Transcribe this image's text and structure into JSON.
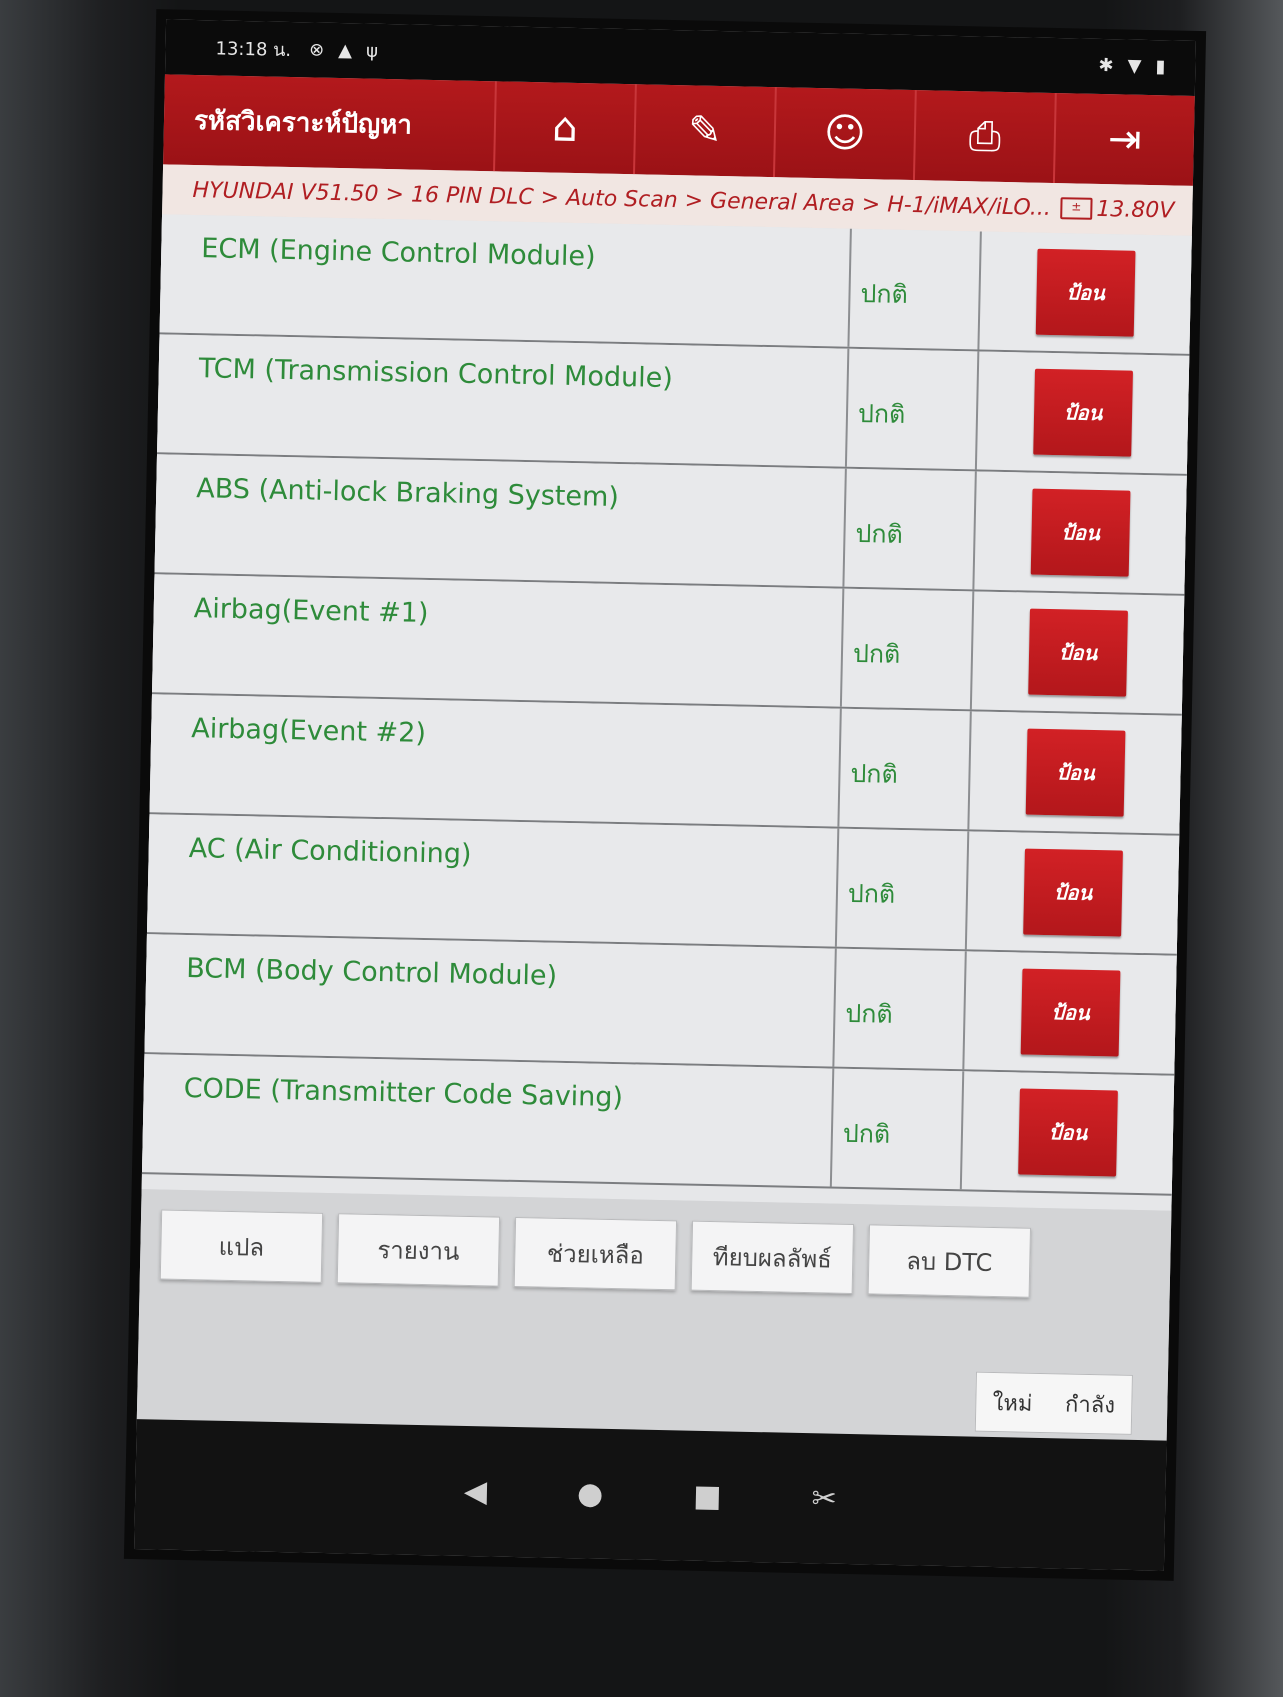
{
  "status_bar": {
    "time": "13:18 น.",
    "icons": [
      "no-disturb-icon",
      "warning-icon",
      "usb-debug-icon"
    ],
    "right_icons": [
      "bluetooth-icon",
      "wifi-icon",
      "battery-icon"
    ]
  },
  "app_bar": {
    "title": "รหัสวิเคราะห์ปัญหา",
    "nav": [
      {
        "icon": "home-icon",
        "glyph": "⌂"
      },
      {
        "icon": "edit-icon",
        "glyph": "✎"
      },
      {
        "icon": "support-icon",
        "glyph": "☺"
      },
      {
        "icon": "print-icon",
        "glyph": "⎙"
      },
      {
        "icon": "exit-icon",
        "glyph": "⇥"
      }
    ]
  },
  "breadcrumb": {
    "path": "HYUNDAI V51.50 > 16 PIN DLC > Auto Scan > General Area > H-1/iMAX/iLO...",
    "voltage": "13.80V"
  },
  "modules": [
    {
      "name": "ECM (Engine Control Module)",
      "status": "ปกติ",
      "action": "ป้อน"
    },
    {
      "name": "TCM (Transmission Control Module)",
      "status": "ปกติ",
      "action": "ป้อน"
    },
    {
      "name": "ABS (Anti-lock Braking System)",
      "status": "ปกติ",
      "action": "ป้อน"
    },
    {
      "name": "Airbag(Event #1)",
      "status": "ปกติ",
      "action": "ป้อน"
    },
    {
      "name": "Airbag(Event #2)",
      "status": "ปกติ",
      "action": "ป้อน"
    },
    {
      "name": "AC (Air Conditioning)",
      "status": "ปกติ",
      "action": "ป้อน"
    },
    {
      "name": "BCM (Body Control Module)",
      "status": "ปกติ",
      "action": "ป้อน"
    },
    {
      "name": "CODE (Transmitter Code Saving)",
      "status": "ปกติ",
      "action": "ป้อน"
    }
  ],
  "bottom_buttons": [
    "แปล",
    "รายงาน",
    "ช่วยเหลือ",
    "ทียบผลลัพธ์",
    "ลบ DTC"
  ],
  "language_box": {
    "left": "ใหม่",
    "right": "กำลัง"
  },
  "nav_bar": [
    {
      "icon": "back-icon",
      "glyph": "◀"
    },
    {
      "icon": "home-circle-icon",
      "glyph": "●"
    },
    {
      "icon": "recents-icon",
      "glyph": "■"
    },
    {
      "icon": "screenshot-icon",
      "glyph": "✂"
    }
  ],
  "colors": {
    "brand_red": "#b3191c",
    "module_text_green": "#2e8b3a",
    "breadcrumb_red": "#b01e22"
  }
}
